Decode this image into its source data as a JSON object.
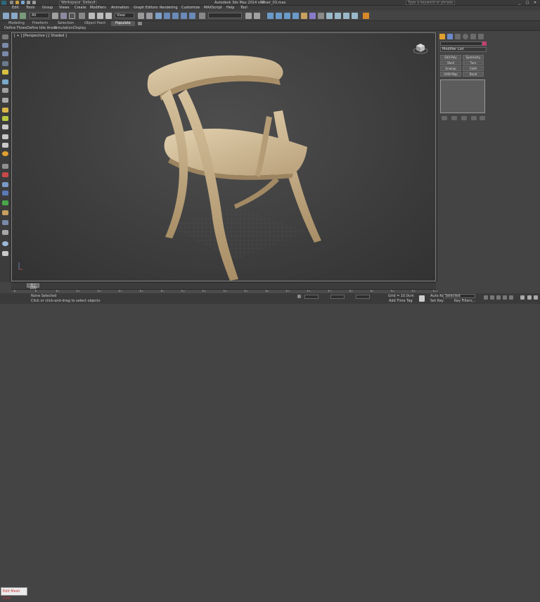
{
  "titlebar": {
    "workspace": "Workspace: Default",
    "app_title": "Autodesk 3ds Max  2014 x64",
    "file": "Chair_03.max",
    "search_placeholder": "Type a keyword or phrase",
    "minimize": "_",
    "maximize": "□",
    "close": "✕"
  },
  "menubar": [
    "Edit",
    "Tools",
    "Group",
    "Views",
    "Create",
    "Modifiers",
    "Animation",
    "Graph Editors",
    "Rendering",
    "Customize",
    "MAXScript",
    "Help",
    "Tool"
  ],
  "toolbar": {
    "filter": "All",
    "refcoord": "View"
  },
  "ribbon": {
    "tabs": [
      "Modeling",
      "Freeform",
      "Selection",
      "Object Paint",
      "Populate"
    ],
    "active": "Populate"
  },
  "subribbon": [
    "Define Flows",
    "Define Idle Areas",
    "Simulation",
    "Display"
  ],
  "viewport": {
    "label": "[ + ] [Perspective ] [ Shaded ]"
  },
  "cmdpanel": {
    "modifier_list": "Modifier List",
    "buttons": [
      "Edit Poly",
      "Symmetry",
      "Shell",
      "Turn",
      "Unwrap",
      "Cloth",
      "UVW Map",
      "Bend"
    ]
  },
  "timeline": {
    "frame": "0 / 100"
  },
  "trackbar": {
    "ticks": [
      "0",
      "5",
      "10",
      "15",
      "20",
      "25",
      "30",
      "35",
      "40",
      "45",
      "50",
      "55",
      "60",
      "65",
      "70",
      "75",
      "80",
      "85",
      "90",
      "95",
      "100"
    ]
  },
  "status": {
    "maxscript": "Edit Mesh Com",
    "selection": "None Selected",
    "prompt": "Click or click-and-drag to select objects",
    "grid": "Grid = 10.0cm",
    "add_time_tag": "Add Time Tag",
    "auto_key": "Auto Key",
    "set_key": "Set Key",
    "selected": "Selected",
    "key_filters": "Key Filters..."
  }
}
